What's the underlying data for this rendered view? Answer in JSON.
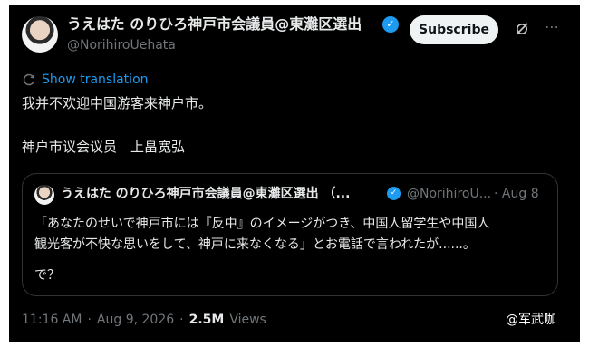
{
  "author": {
    "name": "うえはた のりひろ神戸市会議員@東灘区選出 （...",
    "handle": "@NorihiroUehata"
  },
  "actions": {
    "subscribe_label": "Subscribe"
  },
  "translation": {
    "label": "Show translation"
  },
  "tweet": {
    "line1": "我并不欢迎中国游客来神户市。",
    "line2": "神户市议会议员　上畠宽弘"
  },
  "quote": {
    "name": "うえはた のりひろ神戸市会議員@東灘区選出 （...",
    "handle": "@NorihiroU...",
    "date": "· Aug 8",
    "line1": "「あなたのせいで神戸市には『反中』のイメージがつき、中国人留学生や中国人",
    "line2": "観光客が不快な思いをして、神戸に来なくなる」とお電話で言われたが......。",
    "line3": "で？"
  },
  "meta": {
    "time": "11:16 AM",
    "sep1": "·",
    "date": "Aug 9, 2026",
    "sep2": "·",
    "views": "2.5M",
    "views_label": "Views"
  },
  "watermark": {
    "text": "@军武咖"
  },
  "colors": {
    "background": "#000000",
    "text": "#e7e9ea",
    "muted": "#71767b",
    "accent": "#1d9bf0",
    "border": "#2f3336"
  },
  "icons": {
    "verified": "verified-badge-icon",
    "grok": "grok-icon",
    "more": "more-icon",
    "translate": "translate-icon"
  }
}
